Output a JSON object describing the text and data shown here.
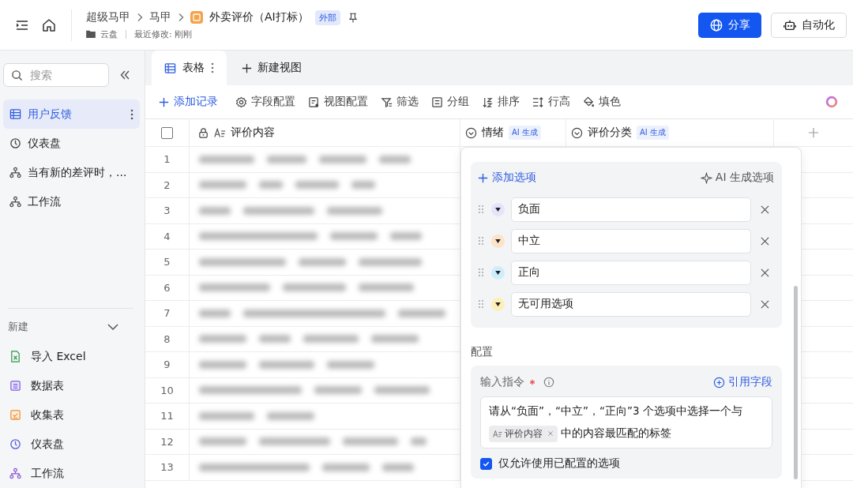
{
  "header": {
    "breadcrumb": [
      "超级马甲",
      "马甲"
    ],
    "doc_title": "外卖评价（AI打标）",
    "badge": "外部",
    "location": "云盘",
    "modified": "最近修改: 刚刚",
    "share_button": "分享",
    "automation_button": "自动化"
  },
  "sidebar": {
    "search": {
      "placeholder": "搜索"
    },
    "items": [
      {
        "label": "用户反馈",
        "kind": "table",
        "selected": true
      },
      {
        "label": "仪表盘",
        "kind": "dashboard",
        "selected": false
      },
      {
        "label": "当有新的差评时，...",
        "kind": "workflow",
        "selected": false
      },
      {
        "label": "工作流",
        "kind": "workflow",
        "selected": false
      }
    ],
    "new_section": {
      "title": "新建",
      "expanded": true,
      "items": [
        {
          "label": "导入 Excel",
          "kind": "excel"
        },
        {
          "label": "数据表",
          "kind": "table"
        },
        {
          "label": "收集表",
          "kind": "form"
        },
        {
          "label": "仪表盘",
          "kind": "dashboard"
        },
        {
          "label": "工作流",
          "kind": "workflow"
        }
      ]
    }
  },
  "tabs": [
    {
      "label": "表格",
      "selected": true
    }
  ],
  "new_view": "新建视图",
  "toolbar": [
    {
      "label": "添加记录",
      "kind": "add"
    },
    {
      "label": "字段配置",
      "kind": "gear"
    },
    {
      "label": "视图配置",
      "kind": "doc"
    },
    {
      "label": "筛选",
      "kind": "filter"
    },
    {
      "label": "分组",
      "kind": "group"
    },
    {
      "label": "排序",
      "kind": "sort"
    },
    {
      "label": "行高",
      "kind": "height"
    },
    {
      "label": "填色",
      "kind": "fill"
    }
  ],
  "table": {
    "columns": [
      {
        "label": "评价内容",
        "kind": "text"
      },
      {
        "label": "情绪",
        "kind": "ai",
        "badge": "AI 生成"
      },
      {
        "label": "评价分类",
        "kind": "ai",
        "badge": "AI 生成"
      }
    ],
    "select_all_checked": false,
    "rows": [
      "1",
      "2",
      "3",
      "4",
      "5",
      "6",
      "7",
      "8",
      "9",
      "10",
      "11",
      "12",
      "13"
    ]
  },
  "panel": {
    "add_option": "添加选项",
    "ai_option": "AI 生成选项",
    "options": [
      {
        "label": "负面",
        "color": "#e3e5fb"
      },
      {
        "label": "中立",
        "color": "#fde3c8"
      },
      {
        "label": "正向",
        "color": "#cdeefc"
      },
      {
        "label": "无可用选项",
        "color": "#fdefb8"
      }
    ],
    "config_title": "配置",
    "instruction": {
      "label": "输入指令",
      "required": true,
      "cite": "引用字段",
      "text_before": "请从“负面”，“中立”，“正向”3 个选项中选择一个与",
      "field_tag": "评价内容",
      "text_after": "中的内容最匹配的标签"
    },
    "restrict": {
      "label": "仅允许使用已配置的选项",
      "checked": true
    }
  }
}
